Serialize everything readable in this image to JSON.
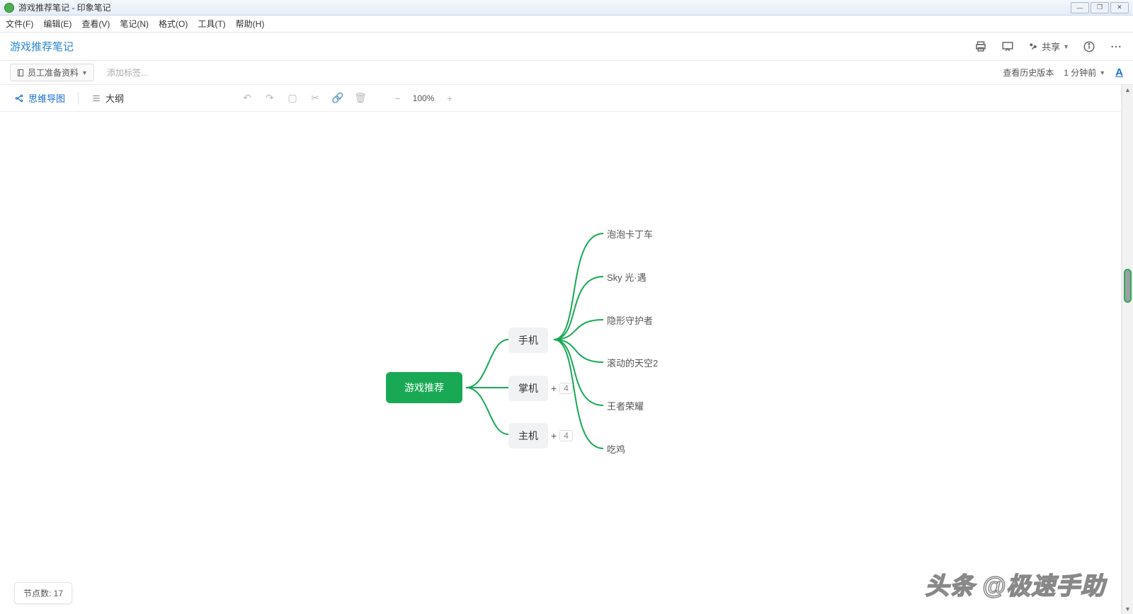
{
  "window": {
    "title": "游戏推荐笔记 - 印象笔记"
  },
  "menus": [
    "文件(F)",
    "编辑(E)",
    "查看(V)",
    "笔记(N)",
    "格式(O)",
    "工具(T)",
    "帮助(H)"
  ],
  "note": {
    "title": "游戏推荐笔记"
  },
  "actions": {
    "share": "共享"
  },
  "meta": {
    "notebook": "员工准备资料",
    "add_tag_placeholder": "添加标签...",
    "history": "查看历史版本",
    "time": "1 分钟前"
  },
  "toolbar": {
    "mindmap": "思维导图",
    "outline": "大纲",
    "zoom": "100%"
  },
  "mindmap": {
    "root": "游戏推荐",
    "subs": [
      {
        "label": "手机",
        "badge": null
      },
      {
        "label": "掌机",
        "badge": "4"
      },
      {
        "label": "主机",
        "badge": "4"
      }
    ],
    "leaves": [
      "泡泡卡丁车",
      "Sky 光·遇",
      "隐形守护者",
      "滚动的天空2",
      "王者荣耀",
      "吃鸡"
    ]
  },
  "footer": {
    "node_count": "节点数: 17"
  },
  "watermark": "头条 @极速手助"
}
